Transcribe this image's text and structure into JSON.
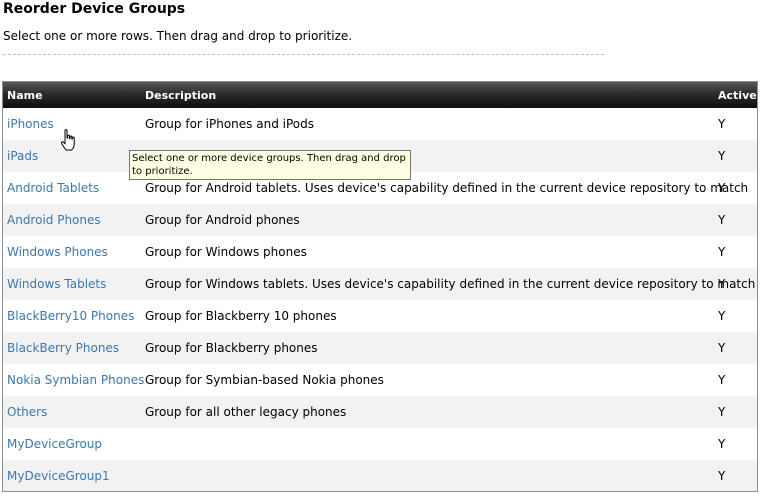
{
  "page": {
    "title": "Reorder Device Groups",
    "instructions": "Select one or more rows. Then drag and drop to prioritize."
  },
  "table": {
    "headers": {
      "name": "Name",
      "description": "Description",
      "active": "Active"
    },
    "rows": [
      {
        "name": "iPhones",
        "description": "Group for iPhones and iPods",
        "active": "Y"
      },
      {
        "name": "iPads",
        "description": "",
        "active": "Y"
      },
      {
        "name": "Android Tablets",
        "description": "Group for Android tablets. Uses device's capability defined in the current device repository to match",
        "active": "Y"
      },
      {
        "name": "Android Phones",
        "description": "Group for Android phones",
        "active": "Y"
      },
      {
        "name": "Windows Phones",
        "description": "Group for Windows phones",
        "active": "Y"
      },
      {
        "name": "Windows Tablets",
        "description": "Group for Windows tablets. Uses device's capability defined in the current device repository to match",
        "active": "Y"
      },
      {
        "name": "BlackBerry10 Phones",
        "description": "Group for Blackberry 10 phones",
        "active": "Y"
      },
      {
        "name": "BlackBerry Phones",
        "description": "Group for Blackberry phones",
        "active": "Y"
      },
      {
        "name": "Nokia Symbian Phones",
        "description": "Group for Symbian-based Nokia phones",
        "active": "Y"
      },
      {
        "name": "Others",
        "description": "Group for all other legacy phones",
        "active": "Y"
      },
      {
        "name": "MyDeviceGroup",
        "description": "",
        "active": "Y"
      },
      {
        "name": "MyDeviceGroup1",
        "description": "",
        "active": "Y"
      }
    ]
  },
  "tooltip": {
    "text": "Select one or more device groups. Then drag and drop to prioritize."
  },
  "cursor": {
    "icon": "hand-pointer-icon"
  },
  "colors": {
    "link": "#3a78b0",
    "header_bg": "#1a1a1a",
    "alt_row": "#f2f2f2",
    "tooltip_bg": "#ffffe1"
  }
}
